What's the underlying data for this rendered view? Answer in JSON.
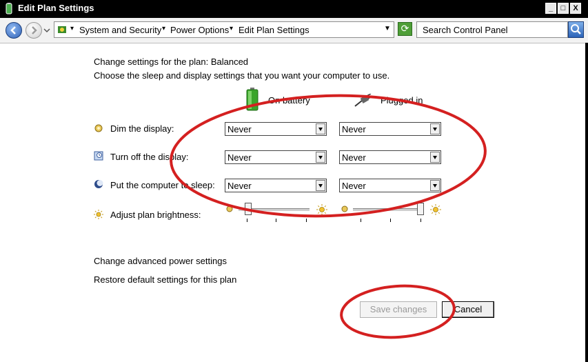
{
  "window": {
    "title": "Edit Plan Settings",
    "min_glyph": "_",
    "max_glyph": "□",
    "close_glyph": "X"
  },
  "address": {
    "crumbs": [
      "System and Security",
      "Power Options",
      "Edit Plan Settings"
    ],
    "search_placeholder": "Search Control Panel"
  },
  "content": {
    "plan_heading": "Change settings for the plan: Balanced",
    "subheading": "Choose the sleep and display settings that you want your computer to use.",
    "col_battery": "On battery",
    "col_plugged": "Plugged in",
    "rows": [
      {
        "label": "Dim the display:",
        "battery": "Never",
        "plugged": "Never",
        "icon": "dim-display-icon"
      },
      {
        "label": "Turn off the display:",
        "battery": "Never",
        "plugged": "Never",
        "icon": "display-off-icon"
      },
      {
        "label": "Put the computer to sleep:",
        "battery": "Never",
        "plugged": "Never",
        "icon": "sleep-moon-icon"
      }
    ],
    "brightness_label": "Adjust plan brightness:",
    "brightness_battery_level": 0.1,
    "brightness_plugged_level": 1.0
  },
  "links": {
    "advanced": "Change advanced power settings",
    "restore": "Restore default settings for this plan"
  },
  "buttons": {
    "save": "Save changes",
    "cancel": "Cancel"
  },
  "colors": {
    "annotation": "#d42020",
    "battery_green": "#3aa52a"
  }
}
